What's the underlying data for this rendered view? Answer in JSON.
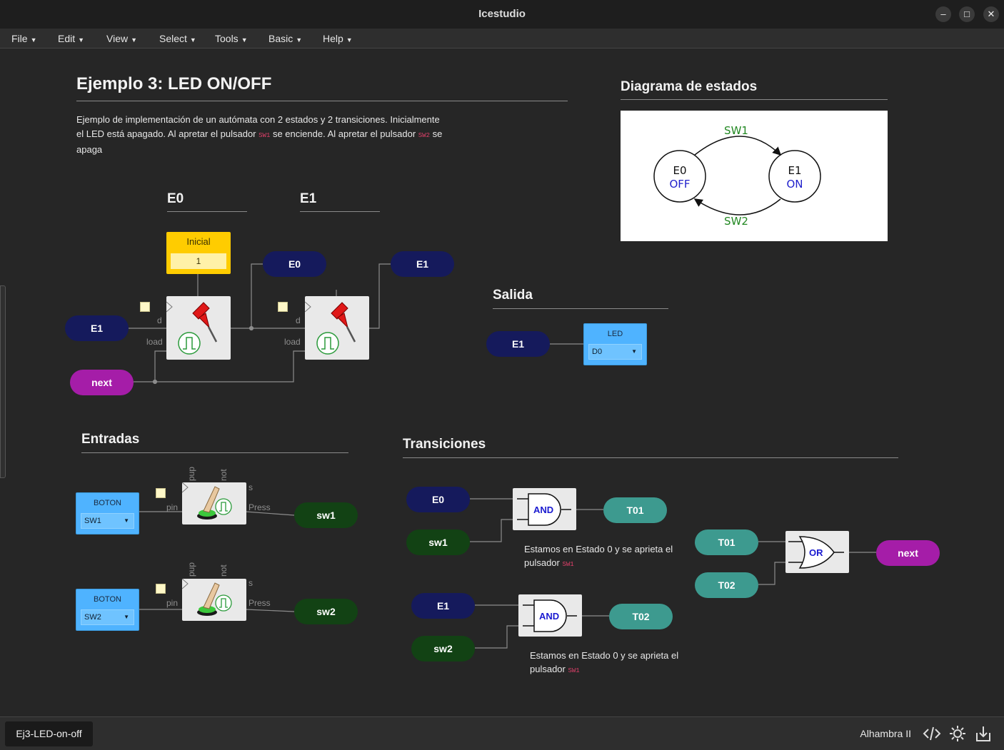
{
  "window": {
    "title": "Icestudio"
  },
  "menu": [
    "File",
    "Edit",
    "View",
    "Select",
    "Tools",
    "Basic",
    "Help"
  ],
  "project": {
    "title": "Ejemplo 3: LED ON/OFF",
    "desc_part1": "Ejemplo de implementación de un autómata con 2 estados y 2 transiciones. Inicialmente el LED está apagado. Al apretar el pulsador",
    "desc_code1": "SW1",
    "desc_part2": "se enciende. Al apretar el pulsador",
    "desc_code2": "SW2",
    "desc_part3": "se apaga"
  },
  "sections": {
    "e0": "E0",
    "e1": "E1",
    "salida": "Salida",
    "entradas": "Entradas",
    "transiciones": "Transiciones",
    "diagrama": "Diagrama de estados"
  },
  "state_block": {
    "inicial_label": "Inicial",
    "inicial_value": "1",
    "port_d": "d",
    "port_load": "load"
  },
  "labels": {
    "e0": "E0",
    "e1": "E1",
    "next": "next",
    "sw1": "sw1",
    "sw2": "sw2",
    "t01": "T01",
    "t02": "T02"
  },
  "led": {
    "label": "LED",
    "pin": "D0"
  },
  "buttons": [
    {
      "label": "BOTON",
      "pin": "SW1",
      "port_pin": "pin",
      "port_press": "Press",
      "port_pup": "pup",
      "port_not": "not",
      "port_s": "s"
    },
    {
      "label": "BOTON",
      "pin": "SW2",
      "port_pin": "pin",
      "port_press": "Press",
      "port_pup": "pup",
      "port_not": "not",
      "port_s": "s"
    }
  ],
  "gates": {
    "and": "AND",
    "or": "OR"
  },
  "notes": {
    "note1_text": "Estamos en Estado 0 y se aprieta el pulsador",
    "note1_code": "SW1",
    "note2_text": "Estamos en Estado 0 y se aprieta el pulsador",
    "note2_code": "SW1"
  },
  "state_diagram": {
    "s0_name": "E0",
    "s0_out": "OFF",
    "s1_name": "E1",
    "s1_out": "ON",
    "t_forward": "SW1",
    "t_back": "SW2"
  },
  "footer": {
    "tab": "Ej3-LED-on-off",
    "board": "Alhambra II"
  },
  "colors": {
    "navy": "#151a5c",
    "purple": "#a51da8",
    "green": "#124214",
    "teal": "#3d9a8f",
    "io_blue": "#4fb3ff",
    "const_yellow": "#ffcc00"
  }
}
